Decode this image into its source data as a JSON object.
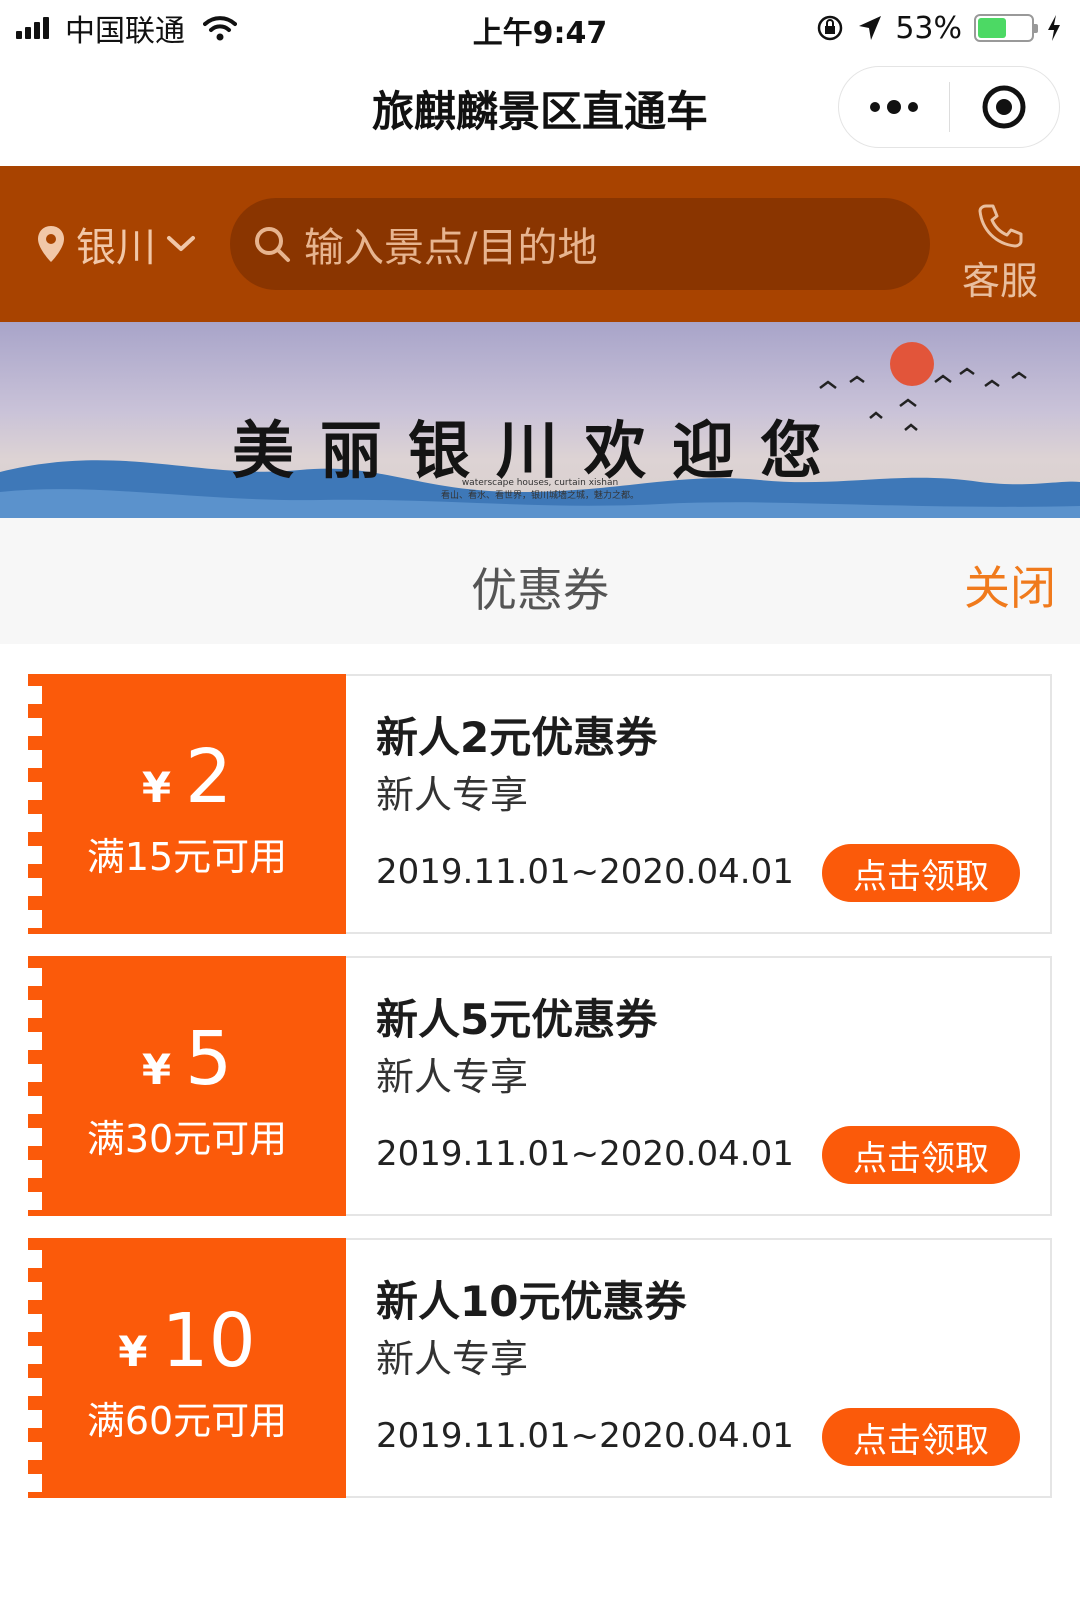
{
  "status_bar": {
    "carrier": "中国联通",
    "time": "上午9:47",
    "battery_percent": "53%",
    "battery_level": 0.53
  },
  "nav": {
    "title": "旅麒麟景区直通车"
  },
  "search_header": {
    "city": "银川",
    "search_placeholder": "输入景点/目的地",
    "service_label": "客服",
    "colors": {
      "background": "#a84300",
      "search_box": "#8a3500"
    }
  },
  "banner": {
    "title": "美丽银川欢迎您",
    "subtitle_en": "waterscape houses, curtain xishan",
    "subtitle_cn": "看山、看水、看世界，银川城墙之城，魅力之都。"
  },
  "coupon_popup": {
    "title": "优惠券",
    "close_label": "关闭",
    "accent_color": "#fb5a0a",
    "coupons": [
      {
        "currency": "¥",
        "amount": "2",
        "threshold": "满15元可用",
        "name": "新人2元优惠券",
        "subtitle": "新人专享",
        "validity": "2019.11.01~2020.04.01",
        "button_label": "点击领取"
      },
      {
        "currency": "¥",
        "amount": "5",
        "threshold": "满30元可用",
        "name": "新人5元优惠券",
        "subtitle": "新人专享",
        "validity": "2019.11.01~2020.04.01",
        "button_label": "点击领取"
      },
      {
        "currency": "¥",
        "amount": "10",
        "threshold": "满60元可用",
        "name": "新人10元优惠券",
        "subtitle": "新人专享",
        "validity": "2019.11.01~2020.04.01",
        "button_label": "点击领取"
      }
    ]
  }
}
